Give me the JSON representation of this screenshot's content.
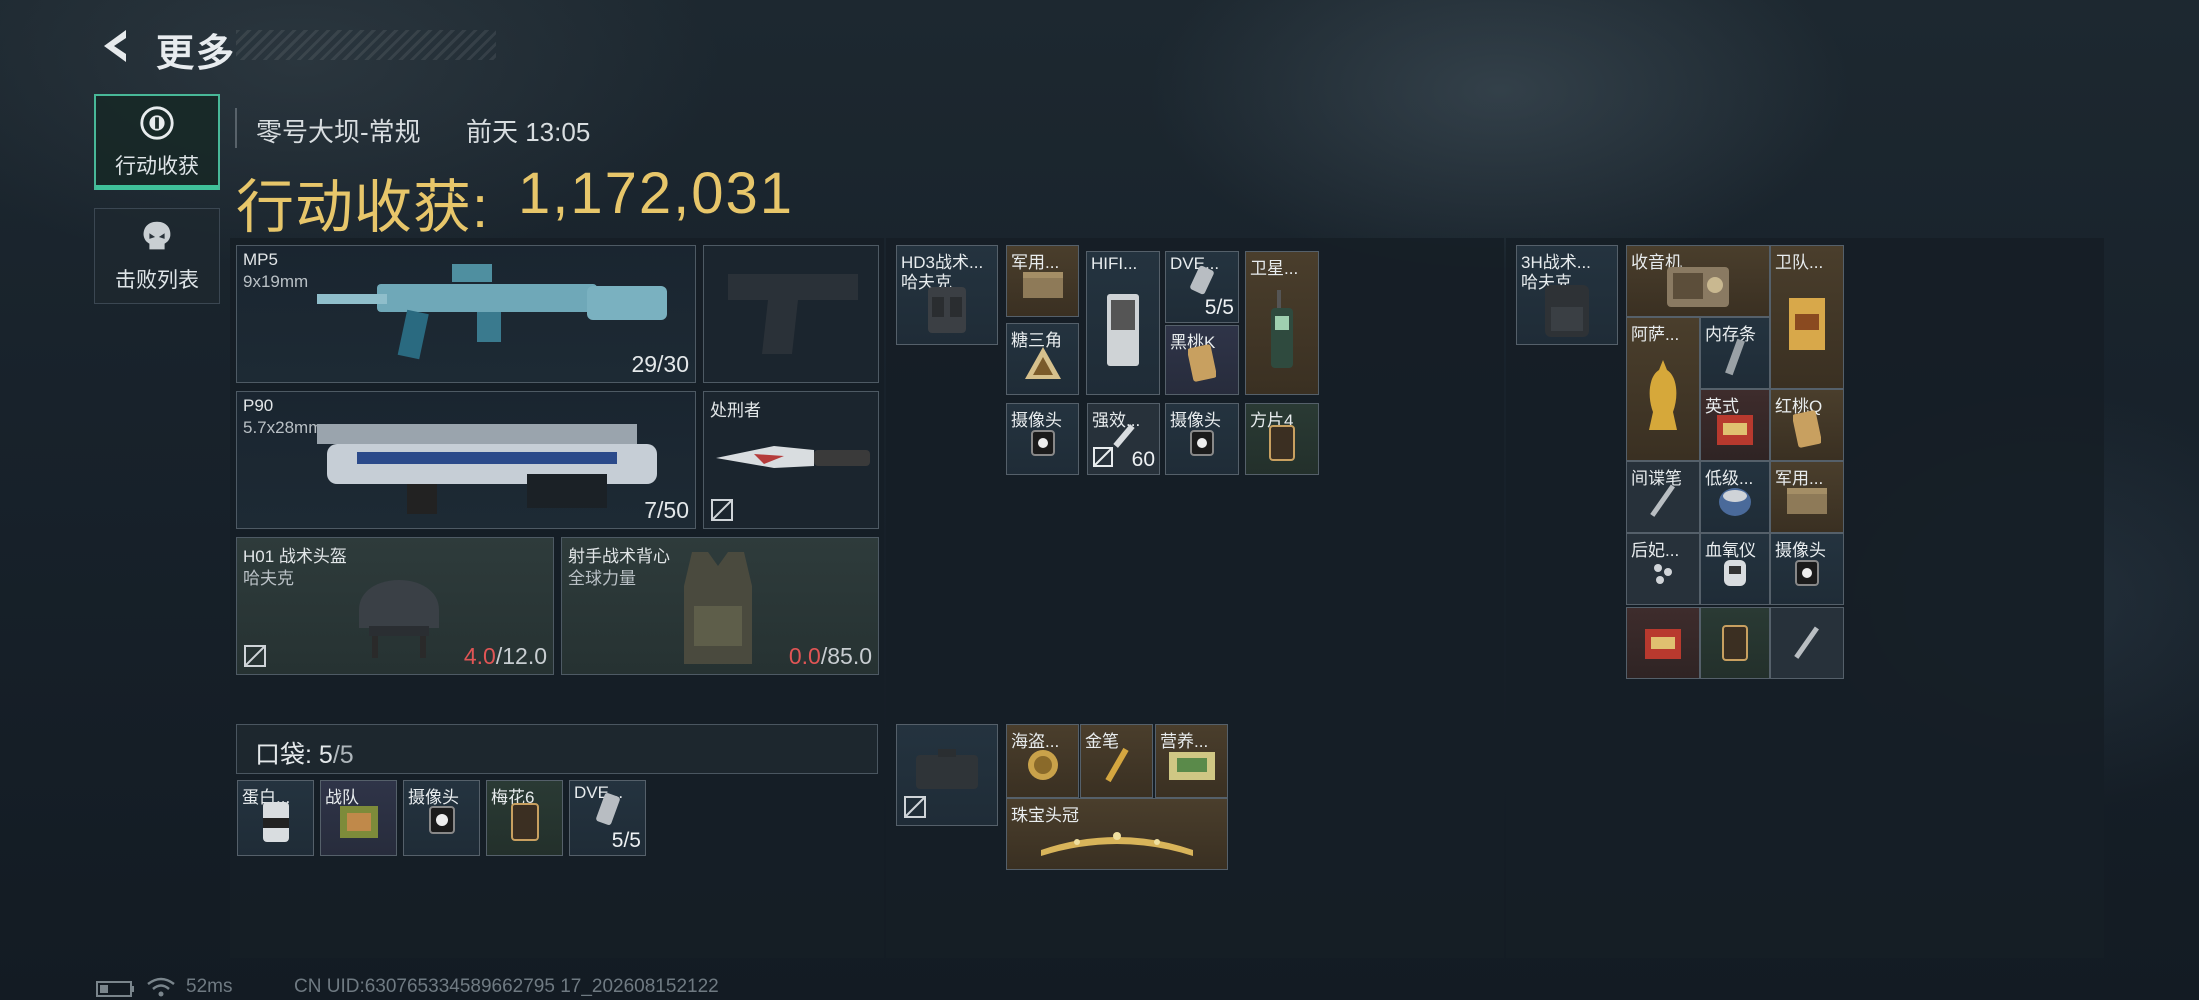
{
  "header": {
    "back_label": "更多",
    "map_name": "零号大坝-常规",
    "time": "前天 13:05",
    "earnings_label": "行动收获:",
    "earnings_value": "1,172,031"
  },
  "tabs": [
    {
      "label": "行动收获",
      "active": true,
      "icon": "loot-icon"
    },
    {
      "label": "击败列表",
      "active": false,
      "icon": "skull-icon"
    }
  ],
  "loadout": {
    "primary": {
      "name": "MP5",
      "ammo": "9x19mm",
      "count": "29/30"
    },
    "pistol": {
      "name": ""
    },
    "secondary": {
      "name": "P90",
      "ammo": "5.7x28mm",
      "count": "7/50"
    },
    "melee": {
      "name": "处刑者"
    },
    "helmet": {
      "name": "H01 战术头盔",
      "brand": "哈夫克",
      "dur_cur": "4.0",
      "dur_max": "/12.0"
    },
    "armor": {
      "name": "射手战术背心",
      "brand": "全球力量",
      "dur_cur": "0.0",
      "dur_max": "/85.0"
    }
  },
  "pocket": {
    "label": "口袋:",
    "count_cur": "5",
    "count_max": "/5",
    "items": [
      {
        "name": "蛋白..."
      },
      {
        "name": "战队"
      },
      {
        "name": "摄像头"
      },
      {
        "name": "梅花6"
      },
      {
        "name": "DVE...",
        "count": "5/5"
      }
    ]
  },
  "chest_rig": {
    "name": "HD3战术...",
    "brand": "哈夫克",
    "items": [
      {
        "name": "军用..."
      },
      {
        "name": "糖三角"
      },
      {
        "name": "HIFI..."
      },
      {
        "name": "DVE...",
        "count": "5/5"
      },
      {
        "name": "黑桃K"
      },
      {
        "name": "卫星..."
      },
      {
        "name": "摄像头"
      },
      {
        "name": "强效...",
        "count": "60"
      },
      {
        "name": "摄像头"
      },
      {
        "name": "方片4"
      }
    ]
  },
  "case": {
    "items": [
      {
        "name": "海盗..."
      },
      {
        "name": "金笔"
      },
      {
        "name": "营养..."
      },
      {
        "name": "珠宝头冠"
      }
    ]
  },
  "backpack": {
    "name": "3H战术...",
    "brand": "哈夫克",
    "items": [
      {
        "name": "收音机"
      },
      {
        "name": "卫队..."
      },
      {
        "name": "阿萨..."
      },
      {
        "name": "内存条"
      },
      {
        "name": "英式"
      },
      {
        "name": "红桃Q"
      },
      {
        "name": "间谍笔"
      },
      {
        "name": "低级..."
      },
      {
        "name": "军用..."
      },
      {
        "name": "后妃..."
      },
      {
        "name": "血氧仪"
      },
      {
        "name": "摄像头"
      },
      {
        "name": ""
      },
      {
        "name": ""
      },
      {
        "name": ""
      }
    ]
  },
  "status": {
    "ping": "52ms",
    "uid": "CN UID:630765334589662795 17_202608152122"
  }
}
